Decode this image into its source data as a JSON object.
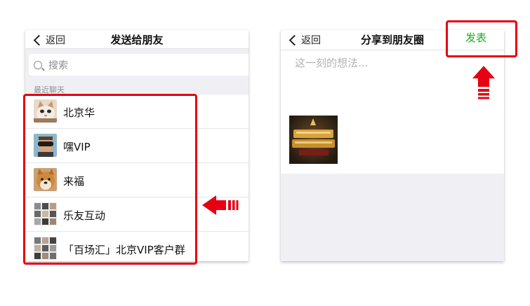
{
  "left_panel": {
    "back_label": "返回",
    "title": "发送给朋友",
    "search_placeholder": "搜索",
    "section_label": "最近聊天",
    "contacts": [
      {
        "name": "北京华",
        "avatar": "kitten-photo"
      },
      {
        "name": "嘿VIP",
        "avatar": "man-with-glasses-photo"
      },
      {
        "name": "来福",
        "avatar": "shiba-dog-photo"
      },
      {
        "name": "乐友互动",
        "avatar": "group-collage"
      },
      {
        "name": "「百场汇」北京VIP客户群",
        "avatar": "group-collage"
      }
    ]
  },
  "right_panel": {
    "back_label": "返回",
    "title": "分享到朋友圈",
    "publish_label": "发表",
    "compose_placeholder": "这一刻的想法...",
    "thumbnail_icon": "game-banner-image"
  },
  "annotations": {
    "highlight_color": "#e60012",
    "publish_color": "#1aad19",
    "arrow_icons": [
      "left-arrow-icon",
      "up-arrow-icon"
    ]
  }
}
